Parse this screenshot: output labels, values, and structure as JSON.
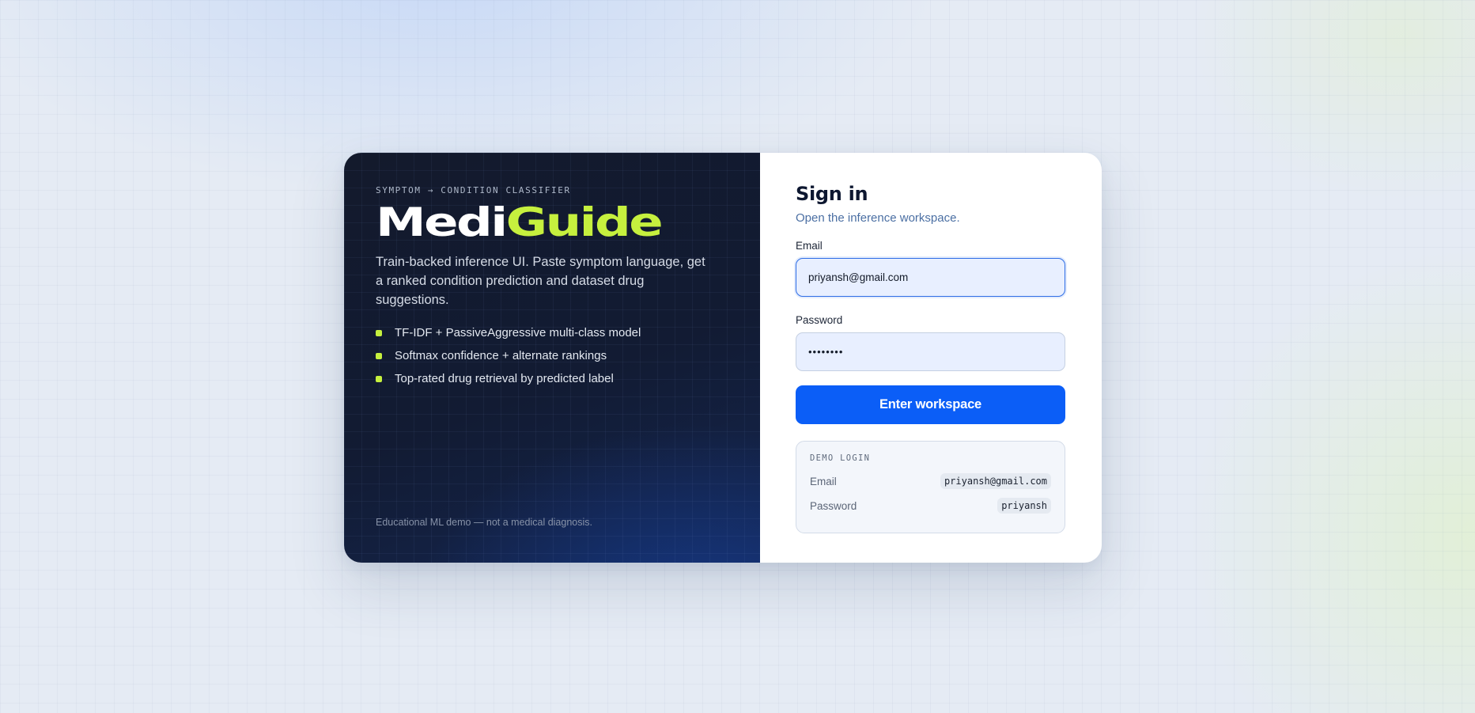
{
  "brand": {
    "kicker": "SYMPTOM → CONDITION CLASSIFIER",
    "name_part1": "Medi",
    "name_part2": "Guide",
    "tagline": "Train-backed inference UI. Paste symptom language, get a ranked condition prediction and dataset drug suggestions.",
    "features": [
      "TF-IDF + PassiveAggressive multi-class model",
      "Softmax confidence + alternate rankings",
      "Top-rated drug retrieval by predicted label"
    ],
    "disclaimer": "Educational ML demo — not a medical diagnosis."
  },
  "signin": {
    "title": "Sign in",
    "subtitle": "Open the inference workspace.",
    "email_label": "Email",
    "email_value": "priyansh@gmail.com",
    "password_label": "Password",
    "password_value": "••••••••",
    "submit_label": "Enter workspace"
  },
  "demo": {
    "title": "DEMO LOGIN",
    "email_label": "Email",
    "email_value": "priyansh@gmail.com",
    "password_label": "Password",
    "password_value": "priyansh"
  },
  "colors": {
    "accent_lime": "#c6f03e",
    "primary_blue": "#0b5ef7",
    "panel_dark": "#131a2c"
  }
}
